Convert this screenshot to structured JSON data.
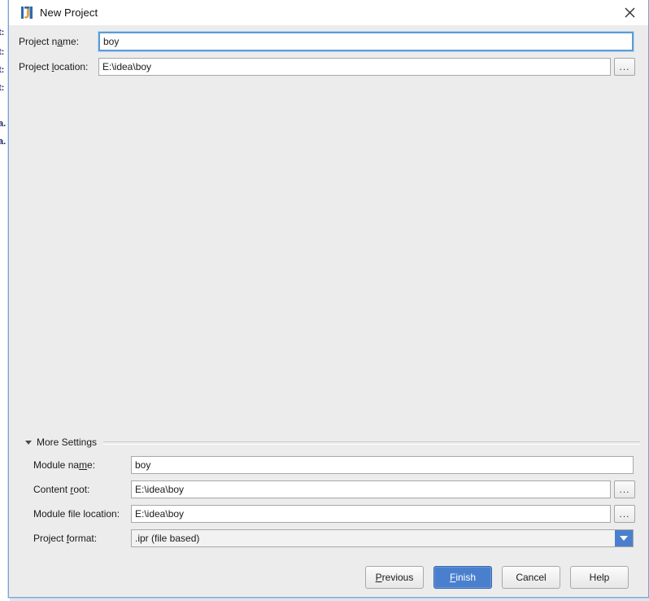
{
  "window": {
    "title": "New Project",
    "app_icon": "intellij-idea-icon",
    "close_icon": "close-icon"
  },
  "background_window": {
    "fragments": [
      "t:",
      "t:",
      "t:",
      "t:",
      "a.",
      "a."
    ]
  },
  "form": {
    "project_name": {
      "label_pre": "Project n",
      "label_mnemonic": "a",
      "label_post": "me:",
      "value": "boy",
      "placeholder": ""
    },
    "project_location": {
      "label_pre": "Project ",
      "label_mnemonic": "l",
      "label_post": "ocation:",
      "value": "E:\\idea\\boy",
      "placeholder": "",
      "browse_label": "..."
    }
  },
  "more_settings": {
    "label": "More Settings",
    "expanded": true,
    "triangle_icon": "chevron-down-icon",
    "module_name": {
      "label_pre": "Module na",
      "label_mnemonic": "m",
      "label_post": "e:",
      "value": "boy"
    },
    "content_root": {
      "label_pre": "Content ",
      "label_mnemonic": "r",
      "label_post": "oot:",
      "value": "E:\\idea\\boy",
      "browse_label": "..."
    },
    "module_file_location": {
      "label_pre": "Module file location:",
      "label_mnemonic": "",
      "label_post": "",
      "value": "E:\\idea\\boy",
      "browse_label": "..."
    },
    "project_format": {
      "label_pre": "Project ",
      "label_mnemonic": "f",
      "label_post": "ormat:",
      "value": ".ipr (file based)",
      "arrow_icon": "chevron-down-icon"
    }
  },
  "buttons": {
    "previous": {
      "pre": "",
      "mnemonic": "P",
      "post": "revious"
    },
    "finish": {
      "pre": "",
      "mnemonic": "F",
      "post": "inish"
    },
    "cancel": {
      "pre": "Cancel",
      "mnemonic": "",
      "post": ""
    },
    "help": {
      "pre": "Help",
      "mnemonic": "",
      "post": ""
    }
  },
  "colors": {
    "dialog_bg": "#ececec",
    "accent_blue": "#4a7fce",
    "focus_blue": "#5b9bd5",
    "field_bg": "#ffffff"
  }
}
